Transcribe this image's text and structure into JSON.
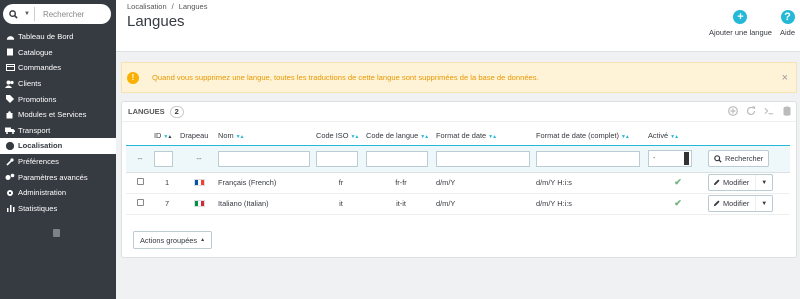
{
  "search": {
    "placeholder": "Rechercher"
  },
  "sidebar": {
    "items": [
      {
        "label": "Tableau de Bord",
        "icon": "dashboard-icon"
      },
      {
        "label": "Catalogue",
        "icon": "book-icon"
      },
      {
        "label": "Commandes",
        "icon": "credit-card-icon"
      },
      {
        "label": "Clients",
        "icon": "users-icon"
      },
      {
        "label": "Promotions",
        "icon": "tags-icon"
      },
      {
        "label": "Modules et Services",
        "icon": "puzzle-icon"
      },
      {
        "label": "Transport",
        "icon": "truck-icon"
      },
      {
        "label": "Localisation",
        "icon": "globe-icon",
        "active": true
      },
      {
        "label": "Préférences",
        "icon": "wrench-icon"
      },
      {
        "label": "Paramètres avancés",
        "icon": "cogs-icon"
      },
      {
        "label": "Administration",
        "icon": "cog-icon"
      },
      {
        "label": "Statistiques",
        "icon": "bar-chart-icon"
      }
    ]
  },
  "header": {
    "breadcrumb": [
      "Localisation",
      "/",
      "Langues"
    ],
    "title": "Langues",
    "add_label": "Ajouter une langue",
    "help_label": "Aide"
  },
  "alert": {
    "icon": "!",
    "text": "Quand vous supprimez une langue, toutes les traductions de cette langue sont supprimées de la base de données.",
    "close": "×"
  },
  "panel": {
    "title": "Langues",
    "count": "2",
    "columns": [
      "ID",
      "Drapeau",
      "Nom",
      "Code ISO",
      "Code de langue",
      "Format de date",
      "Format de date (complet)",
      "Activé"
    ],
    "filter": {
      "dash": "--",
      "dash2": "--",
      "select_value": "-",
      "search_label": "Rechercher"
    },
    "rows": [
      {
        "id": "1",
        "name": "Français (French)",
        "iso": "fr",
        "lang_code": "fr-fr",
        "date_format": "d/m/Y",
        "date_full": "d/m/Y H:i:s",
        "active": "✔",
        "flag": [
          "#0055a4",
          "#ffffff",
          "#ef4135"
        ]
      },
      {
        "id": "7",
        "name": "Italiano (Italian)",
        "iso": "it",
        "lang_code": "it-it",
        "date_format": "d/m/Y",
        "date_full": "d/m/Y H:i:s",
        "active": "✔",
        "flag": [
          "#009246",
          "#ffffff",
          "#ce2b37"
        ]
      }
    ],
    "edit_label": "Modifier",
    "bulk_label": "Actions groupées"
  },
  "colors": {
    "accent": "#25b9d7",
    "sidebar": "#363a41",
    "warning": "#fab000",
    "success": "#70b580"
  }
}
